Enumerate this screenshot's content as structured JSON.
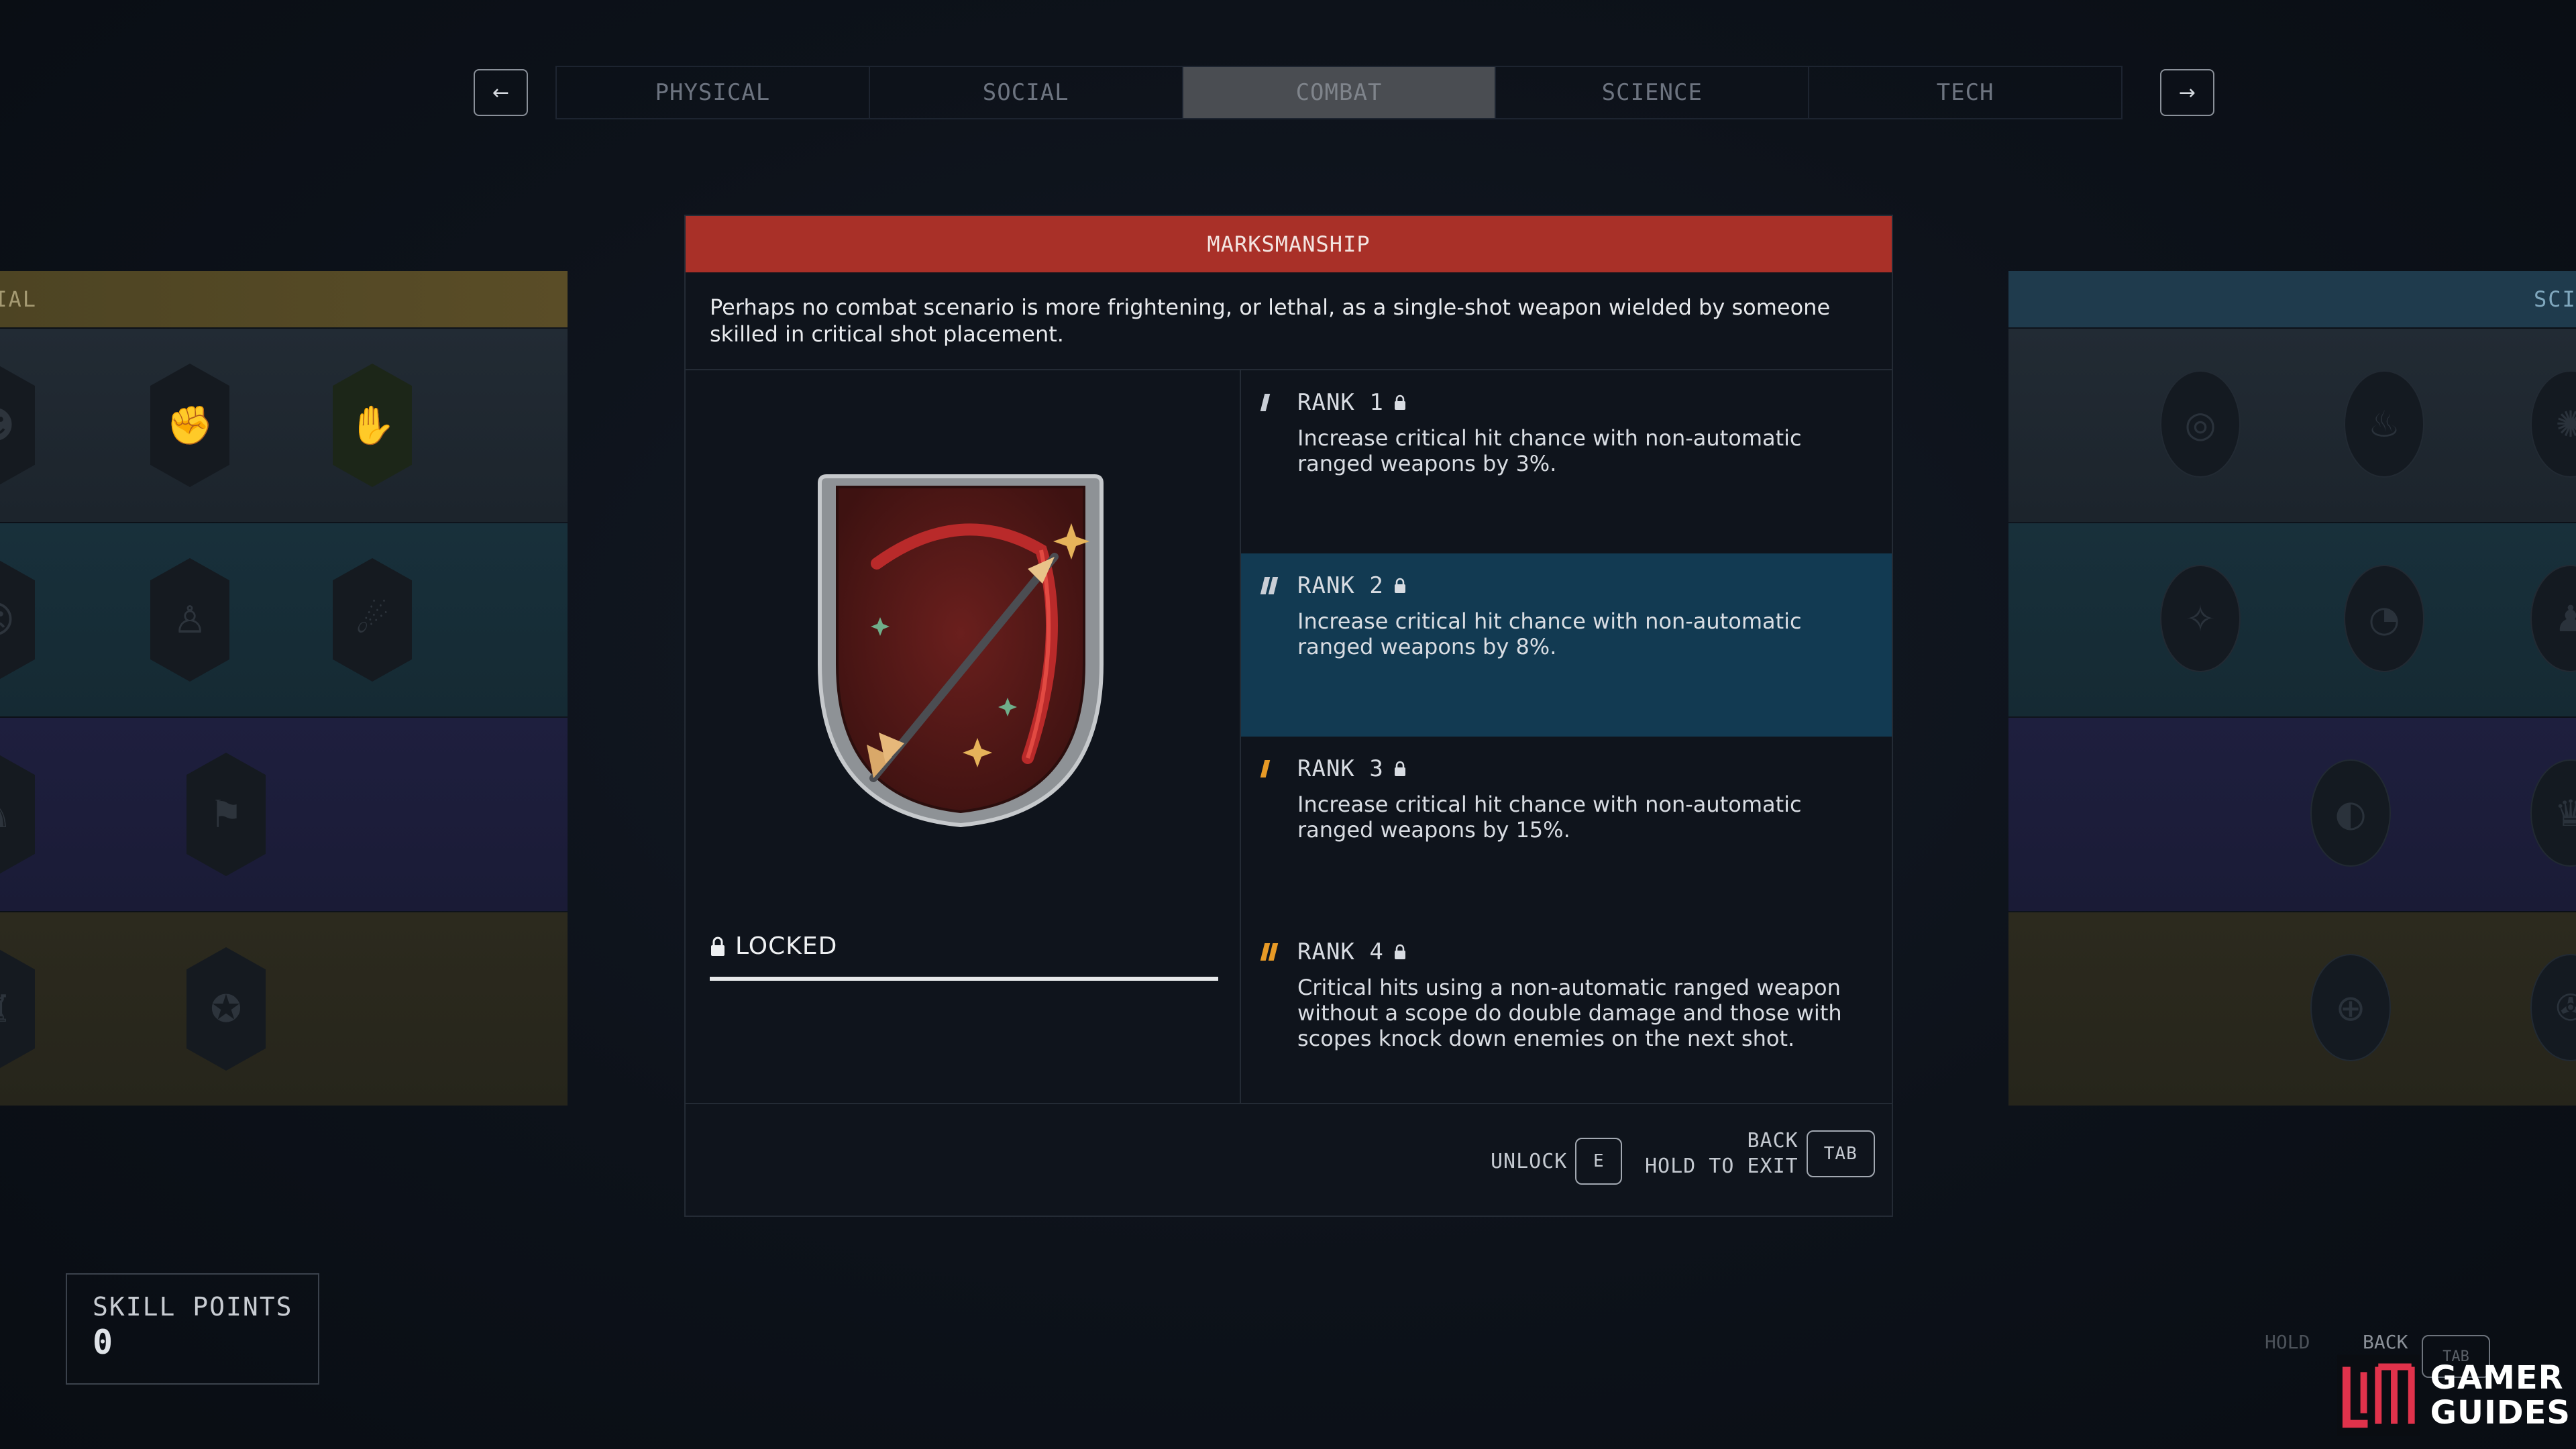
{
  "nav": {
    "prev_icon": "arrow-left-icon",
    "prev_glyph": "←",
    "next_icon": "arrow-right-icon",
    "next_glyph": "→",
    "tabs": [
      {
        "label": "PHYSICAL",
        "active": false
      },
      {
        "label": "SOCIAL",
        "active": false
      },
      {
        "label": "COMBAT",
        "active": true
      },
      {
        "label": "SCIENCE",
        "active": false
      },
      {
        "label": "TECH",
        "active": false
      }
    ]
  },
  "side_left": {
    "header": "CIAL",
    "color": "#5a4d27"
  },
  "side_right": {
    "header": "SCIE",
    "color": "#1f3b4d"
  },
  "skill": {
    "title": "MARKSMANSHIP",
    "title_color": "#a93028",
    "description": "Perhaps no combat scenario is more frightening, or lethal, as a single-shot weapon wielded by someone skilled in critical shot placement.",
    "status": "LOCKED",
    "badge_icon": "bow-and-arrow-badge-icon",
    "ranks": [
      {
        "label": "RANK 1",
        "description": "Increase critical hit chance with non-automatic ranged weapons by 3%."
      },
      {
        "label": "RANK 2",
        "description": "Increase critical hit chance with non-automatic ranged weapons by 8%."
      },
      {
        "label": "RANK 3",
        "description": "Increase critical hit chance with non-automatic ranged weapons by 15%."
      },
      {
        "label": "RANK 4",
        "description": "Critical hits using a non-automatic ranged weapon without a scope do double damage and those with scopes knock down enemies on the next shot."
      }
    ],
    "selected_rank": 2
  },
  "footer": {
    "unlock_label": "UNLOCK",
    "unlock_key": "E",
    "back_label": "BACK",
    "exit_label": "HOLD TO EXIT",
    "back_key": "TAB"
  },
  "skill_points": {
    "label": "SKILL POINTS",
    "value": "0"
  },
  "corner": {
    "hold_label": "HOLD",
    "back_label": "BACK",
    "key": "TAB"
  },
  "watermark": {
    "line1": "GAMER",
    "line2": "GUIDES"
  }
}
